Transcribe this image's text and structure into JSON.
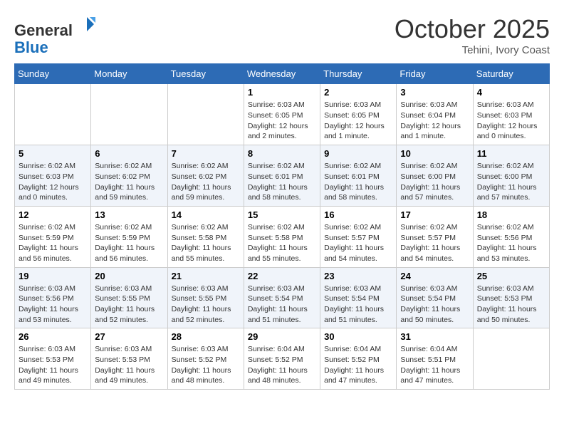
{
  "header": {
    "logo_line1": "General",
    "logo_line2": "Blue",
    "month": "October 2025",
    "location": "Tehini, Ivory Coast"
  },
  "weekdays": [
    "Sunday",
    "Monday",
    "Tuesday",
    "Wednesday",
    "Thursday",
    "Friday",
    "Saturday"
  ],
  "weeks": [
    [
      {
        "day": "",
        "info": ""
      },
      {
        "day": "",
        "info": ""
      },
      {
        "day": "",
        "info": ""
      },
      {
        "day": "1",
        "info": "Sunrise: 6:03 AM\nSunset: 6:05 PM\nDaylight: 12 hours\nand 2 minutes."
      },
      {
        "day": "2",
        "info": "Sunrise: 6:03 AM\nSunset: 6:05 PM\nDaylight: 12 hours\nand 1 minute."
      },
      {
        "day": "3",
        "info": "Sunrise: 6:03 AM\nSunset: 6:04 PM\nDaylight: 12 hours\nand 1 minute."
      },
      {
        "day": "4",
        "info": "Sunrise: 6:03 AM\nSunset: 6:03 PM\nDaylight: 12 hours\nand 0 minutes."
      }
    ],
    [
      {
        "day": "5",
        "info": "Sunrise: 6:02 AM\nSunset: 6:03 PM\nDaylight: 12 hours\nand 0 minutes."
      },
      {
        "day": "6",
        "info": "Sunrise: 6:02 AM\nSunset: 6:02 PM\nDaylight: 11 hours\nand 59 minutes."
      },
      {
        "day": "7",
        "info": "Sunrise: 6:02 AM\nSunset: 6:02 PM\nDaylight: 11 hours\nand 59 minutes."
      },
      {
        "day": "8",
        "info": "Sunrise: 6:02 AM\nSunset: 6:01 PM\nDaylight: 11 hours\nand 58 minutes."
      },
      {
        "day": "9",
        "info": "Sunrise: 6:02 AM\nSunset: 6:01 PM\nDaylight: 11 hours\nand 58 minutes."
      },
      {
        "day": "10",
        "info": "Sunrise: 6:02 AM\nSunset: 6:00 PM\nDaylight: 11 hours\nand 57 minutes."
      },
      {
        "day": "11",
        "info": "Sunrise: 6:02 AM\nSunset: 6:00 PM\nDaylight: 11 hours\nand 57 minutes."
      }
    ],
    [
      {
        "day": "12",
        "info": "Sunrise: 6:02 AM\nSunset: 5:59 PM\nDaylight: 11 hours\nand 56 minutes."
      },
      {
        "day": "13",
        "info": "Sunrise: 6:02 AM\nSunset: 5:59 PM\nDaylight: 11 hours\nand 56 minutes."
      },
      {
        "day": "14",
        "info": "Sunrise: 6:02 AM\nSunset: 5:58 PM\nDaylight: 11 hours\nand 55 minutes."
      },
      {
        "day": "15",
        "info": "Sunrise: 6:02 AM\nSunset: 5:58 PM\nDaylight: 11 hours\nand 55 minutes."
      },
      {
        "day": "16",
        "info": "Sunrise: 6:02 AM\nSunset: 5:57 PM\nDaylight: 11 hours\nand 54 minutes."
      },
      {
        "day": "17",
        "info": "Sunrise: 6:02 AM\nSunset: 5:57 PM\nDaylight: 11 hours\nand 54 minutes."
      },
      {
        "day": "18",
        "info": "Sunrise: 6:02 AM\nSunset: 5:56 PM\nDaylight: 11 hours\nand 53 minutes."
      }
    ],
    [
      {
        "day": "19",
        "info": "Sunrise: 6:03 AM\nSunset: 5:56 PM\nDaylight: 11 hours\nand 53 minutes."
      },
      {
        "day": "20",
        "info": "Sunrise: 6:03 AM\nSunset: 5:55 PM\nDaylight: 11 hours\nand 52 minutes."
      },
      {
        "day": "21",
        "info": "Sunrise: 6:03 AM\nSunset: 5:55 PM\nDaylight: 11 hours\nand 52 minutes."
      },
      {
        "day": "22",
        "info": "Sunrise: 6:03 AM\nSunset: 5:54 PM\nDaylight: 11 hours\nand 51 minutes."
      },
      {
        "day": "23",
        "info": "Sunrise: 6:03 AM\nSunset: 5:54 PM\nDaylight: 11 hours\nand 51 minutes."
      },
      {
        "day": "24",
        "info": "Sunrise: 6:03 AM\nSunset: 5:54 PM\nDaylight: 11 hours\nand 50 minutes."
      },
      {
        "day": "25",
        "info": "Sunrise: 6:03 AM\nSunset: 5:53 PM\nDaylight: 11 hours\nand 50 minutes."
      }
    ],
    [
      {
        "day": "26",
        "info": "Sunrise: 6:03 AM\nSunset: 5:53 PM\nDaylight: 11 hours\nand 49 minutes."
      },
      {
        "day": "27",
        "info": "Sunrise: 6:03 AM\nSunset: 5:53 PM\nDaylight: 11 hours\nand 49 minutes."
      },
      {
        "day": "28",
        "info": "Sunrise: 6:03 AM\nSunset: 5:52 PM\nDaylight: 11 hours\nand 48 minutes."
      },
      {
        "day": "29",
        "info": "Sunrise: 6:04 AM\nSunset: 5:52 PM\nDaylight: 11 hours\nand 48 minutes."
      },
      {
        "day": "30",
        "info": "Sunrise: 6:04 AM\nSunset: 5:52 PM\nDaylight: 11 hours\nand 47 minutes."
      },
      {
        "day": "31",
        "info": "Sunrise: 6:04 AM\nSunset: 5:51 PM\nDaylight: 11 hours\nand 47 minutes."
      },
      {
        "day": "",
        "info": ""
      }
    ]
  ]
}
